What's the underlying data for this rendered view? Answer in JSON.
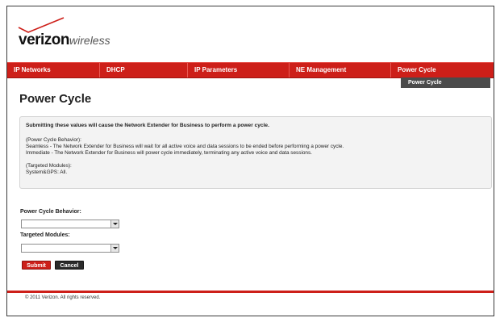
{
  "brand": {
    "name": "verizon",
    "suffix": "wireless",
    "check_color": "#cd1f19"
  },
  "nav": {
    "items": [
      {
        "label": "IP Networks"
      },
      {
        "label": "DHCP"
      },
      {
        "label": "IP Parameters"
      },
      {
        "label": "NE Management"
      },
      {
        "label": "Power Cycle"
      }
    ],
    "submenu_item": "Power Cycle",
    "accent": "#cd1f19"
  },
  "page": {
    "title": "Power Cycle"
  },
  "info": {
    "heading": "Submitting these values will cause the Network Extender for Business to perform a power cycle.",
    "behavior_title": "(Power Cycle Behavior):",
    "seamless": "Seamless - The Network Extender for Business will wait for all active voice and data sessions to be ended before performing a power cycle.",
    "immediate": "Immediate - The Network Extender for Business will power cycle immediately, terminating any active voice and data sessions.",
    "modules_title": "(Targeted Modules):",
    "modules_value": "System&GPS: All."
  },
  "form": {
    "behavior_label": "Power Cycle Behavior:",
    "behavior_value": "",
    "modules_label": "Targeted Modules:",
    "modules_value": "",
    "submit_label": "Submit",
    "cancel_label": "Cancel"
  },
  "footer": {
    "copyright": "© 2011 Verizon. All rights reserved."
  }
}
